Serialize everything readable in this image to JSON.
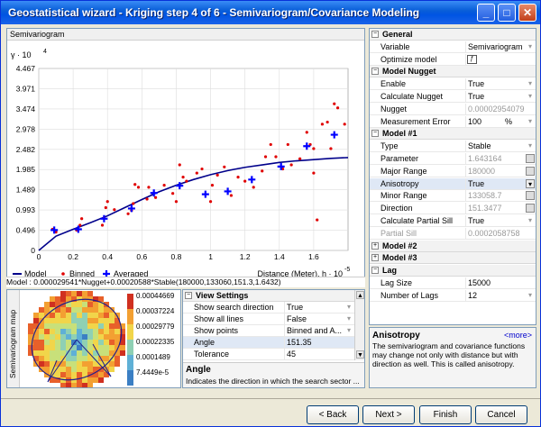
{
  "window": {
    "title": "Geostatistical wizard - Kriging step 4 of 6 - Semivariogram/Covariance Modeling"
  },
  "chart_panel": {
    "title": "Semivariogram"
  },
  "chart_data": {
    "type": "scatter",
    "ylabel": "γ · 10",
    "ylabel_exp": "4",
    "xlabel": "Distance (Meter), h · 10",
    "xlabel_exp": "-5",
    "yticks": [
      "4.467",
      "3.971",
      "3.474",
      "2.978",
      "2.482",
      "1.985",
      "1.489",
      "0.993",
      "0.496",
      "0"
    ],
    "xticks": [
      "0",
      "0.2",
      "0.4",
      "0.6",
      "0.8",
      "1",
      "1.2",
      "1.4",
      "1.6"
    ],
    "xlim": [
      0,
      1.8
    ],
    "ylim": [
      0,
      4.467
    ],
    "binned": [
      [
        0.08,
        0.52
      ],
      [
        0.1,
        0.45
      ],
      [
        0.22,
        0.5
      ],
      [
        0.24,
        0.62
      ],
      [
        0.25,
        0.78
      ],
      [
        0.37,
        0.62
      ],
      [
        0.38,
        0.8
      ],
      [
        0.39,
        1.05
      ],
      [
        0.4,
        1.2
      ],
      [
        0.44,
        1.0
      ],
      [
        0.52,
        0.9
      ],
      [
        0.54,
        0.98
      ],
      [
        0.55,
        1.15
      ],
      [
        0.56,
        1.62
      ],
      [
        0.58,
        1.55
      ],
      [
        0.63,
        1.26
      ],
      [
        0.64,
        1.55
      ],
      [
        0.68,
        1.3
      ],
      [
        0.73,
        1.6
      ],
      [
        0.78,
        1.4
      ],
      [
        0.8,
        1.2
      ],
      [
        0.82,
        2.1
      ],
      [
        0.84,
        1.8
      ],
      [
        0.86,
        1.7
      ],
      [
        0.92,
        1.9
      ],
      [
        0.95,
        2.0
      ],
      [
        1.0,
        1.2
      ],
      [
        1.01,
        1.6
      ],
      [
        1.04,
        1.85
      ],
      [
        1.08,
        2.05
      ],
      [
        1.12,
        1.35
      ],
      [
        1.16,
        1.8
      ],
      [
        1.2,
        1.7
      ],
      [
        1.25,
        1.55
      ],
      [
        1.3,
        1.95
      ],
      [
        1.32,
        2.3
      ],
      [
        1.35,
        2.6
      ],
      [
        1.38,
        2.3
      ],
      [
        1.42,
        2.0
      ],
      [
        1.45,
        2.6
      ],
      [
        1.47,
        2.1
      ],
      [
        1.52,
        2.25
      ],
      [
        1.56,
        2.9
      ],
      [
        1.58,
        2.6
      ],
      [
        1.6,
        2.5
      ],
      [
        1.62,
        0.75
      ],
      [
        1.65,
        3.1
      ],
      [
        1.68,
        3.15
      ],
      [
        1.7,
        2.5
      ],
      [
        1.72,
        3.6
      ],
      [
        1.74,
        3.5
      ],
      [
        1.78,
        3.1
      ],
      [
        1.6,
        1.9
      ]
    ],
    "averaged": [
      [
        0.09,
        0.5
      ],
      [
        0.23,
        0.52
      ],
      [
        0.38,
        0.78
      ],
      [
        0.54,
        1.03
      ],
      [
        0.67,
        1.41
      ],
      [
        0.82,
        1.59
      ],
      [
        0.97,
        1.38
      ],
      [
        1.1,
        1.45
      ],
      [
        1.24,
        1.74
      ],
      [
        1.41,
        2.06
      ],
      [
        1.56,
        2.56
      ],
      [
        1.72,
        2.84
      ]
    ],
    "model": [
      [
        0,
        0.0
      ],
      [
        0.1,
        0.35
      ],
      [
        0.2,
        0.52
      ],
      [
        0.3,
        0.68
      ],
      [
        0.4,
        0.85
      ],
      [
        0.5,
        1.05
      ],
      [
        0.6,
        1.25
      ],
      [
        0.7,
        1.44
      ],
      [
        0.8,
        1.6
      ],
      [
        0.9,
        1.74
      ],
      [
        1.0,
        1.86
      ],
      [
        1.1,
        1.96
      ],
      [
        1.2,
        2.04
      ],
      [
        1.3,
        2.1
      ],
      [
        1.4,
        2.16
      ],
      [
        1.5,
        2.2
      ],
      [
        1.6,
        2.23
      ],
      [
        1.7,
        2.26
      ],
      [
        1.8,
        2.28
      ]
    ],
    "legend": {
      "model": "Model",
      "binned": "Binned",
      "averaged": "Averaged"
    },
    "colors": {
      "model": "#00008b",
      "binned": "#e00000",
      "averaged": "#0000ff"
    }
  },
  "model_formula": "Model : 0.000029541*Nugget+0.00020588*Stable(180000,133060,151.3,1.6432)",
  "semivariogram_map": {
    "label": "Semivariogram map",
    "scale": [
      "0.00044669",
      "0.00037224",
      "0.00029779",
      "0.00022335",
      "0.0001489",
      "7.4449e-5"
    ]
  },
  "view_settings": {
    "title": "View Settings",
    "rows": [
      {
        "k": "Show search direction",
        "v": "True"
      },
      {
        "k": "Show all lines",
        "v": "False"
      },
      {
        "k": "Show points",
        "v": "Binned and A..."
      },
      {
        "k": "Angle",
        "v": "151.35"
      },
      {
        "k": "Tolerance",
        "v": "45"
      }
    ],
    "help_title": "Angle",
    "help_text": "Indicates the direction in which the search sector ..."
  },
  "props": {
    "general": "General",
    "variable_k": "Variable",
    "variable_v": "Semivariogram",
    "optimize_k": "Optimize model",
    "model_nugget": "Model Nugget",
    "enable_k": "Enable",
    "enable_v": "True",
    "calc_nugget_k": "Calculate Nugget",
    "calc_nugget_v": "True",
    "nugget_k": "Nugget",
    "nugget_v": "0.00002954079",
    "meas_err_k": "Measurement Error",
    "meas_err_v": "100",
    "meas_err_unit": "%",
    "model1": "Model #1",
    "type_k": "Type",
    "type_v": "Stable",
    "param_k": "Parameter",
    "param_v": "1.643164",
    "major_k": "Major Range",
    "major_v": "180000",
    "aniso_k": "Anisotropy",
    "aniso_v": "True",
    "minor_k": "Minor Range",
    "minor_v": "133058.7",
    "dir_k": "Direction",
    "dir_v": "151.3477",
    "calc_ps_k": "Calculate Partial Sill",
    "calc_ps_v": "True",
    "ps_k": "Partial Sill",
    "ps_v": "0.0002058758",
    "model2": "Model #2",
    "model3": "Model #3",
    "lag": "Lag",
    "lagsize_k": "Lag Size",
    "lagsize_v": "15000",
    "numlags_k": "Number of Lags",
    "numlags_v": "12"
  },
  "help": {
    "title": "Anisotropy",
    "more": "<more>",
    "text": "The semivariogram and covariance functions may change not only with distance but with direction as well. This is called anisotropy."
  },
  "buttons": {
    "back": "< Back",
    "next": "Next >",
    "finish": "Finish",
    "cancel": "Cancel"
  }
}
